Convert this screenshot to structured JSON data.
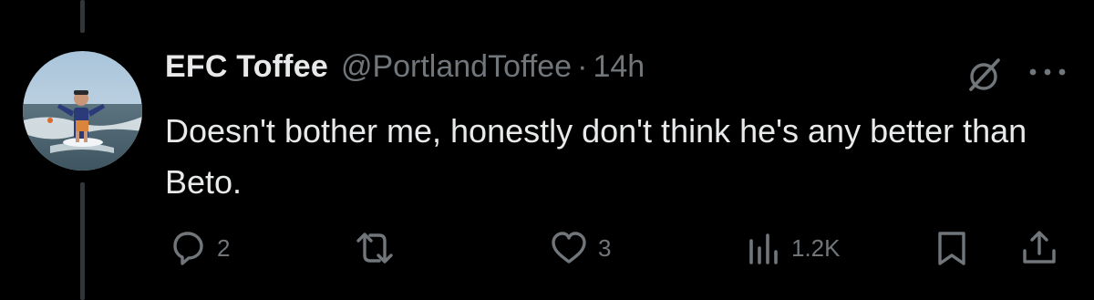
{
  "tweet": {
    "display_name": "EFC Toffee",
    "handle": "@PortlandToffee",
    "separator": "·",
    "time": "14h",
    "text": "Doesn't bother me, honestly don't think he's any better than Beto."
  },
  "actions": {
    "reply": {
      "icon": "reply-icon",
      "count": "2"
    },
    "retweet": {
      "icon": "retweet-icon",
      "count": ""
    },
    "like": {
      "icon": "heart-icon",
      "count": "3"
    },
    "views": {
      "icon": "views-icon",
      "count": "1.2K"
    },
    "bookmark": {
      "icon": "bookmark-icon"
    },
    "share": {
      "icon": "share-icon"
    }
  },
  "header_icons": [
    "grok-icon",
    "more-icon"
  ],
  "colors": {
    "background": "#000000",
    "primary_text": "#e7e9ea",
    "secondary_text": "#71767b",
    "thread_line": "#333639"
  }
}
